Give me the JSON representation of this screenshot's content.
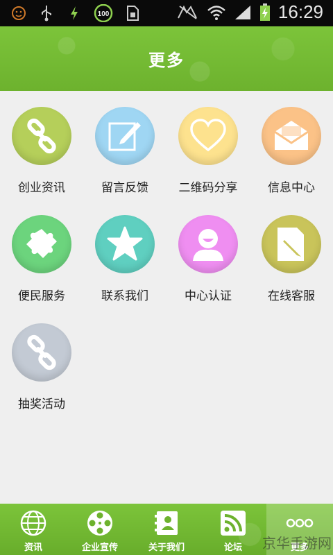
{
  "status_bar": {
    "time": "16:29",
    "battery_badge": "100",
    "icons": [
      "notification-face-icon",
      "usb-icon",
      "charging-bolt-icon",
      "battery-100-icon",
      "sim-icon",
      "no-sim-icon",
      "wifi-icon",
      "signal-icon",
      "battery-charging-icon"
    ]
  },
  "header": {
    "title": "更多"
  },
  "grid": {
    "items": [
      {
        "label": "创业资讯",
        "icon": "link-icon",
        "color": "#b5cf5a"
      },
      {
        "label": "留言反馈",
        "icon": "edit-icon",
        "color": "#9fd6f3"
      },
      {
        "label": "二维码分享",
        "icon": "heart-icon",
        "color": "#fde28e"
      },
      {
        "label": "信息中心",
        "icon": "envelope-icon",
        "color": "#fbc287"
      },
      {
        "label": "便民服务",
        "icon": "puzzle-icon",
        "color": "#6cd47d"
      },
      {
        "label": "联系我们",
        "icon": "star-icon",
        "color": "#5fcfc0"
      },
      {
        "label": "中心认证",
        "icon": "user-icon",
        "color": "#ef8ef1"
      },
      {
        "label": "在线客服",
        "icon": "document-edit-icon",
        "color": "#c9c45a"
      },
      {
        "label": "抽奖活动",
        "icon": "link-icon",
        "color": "#c3cad4"
      }
    ]
  },
  "tabbar": {
    "tabs": [
      {
        "label": "资讯",
        "icon": "globe-icon"
      },
      {
        "label": "企业宣传",
        "icon": "film-reel-icon"
      },
      {
        "label": "关于我们",
        "icon": "contact-book-icon"
      },
      {
        "label": "论坛",
        "icon": "rss-icon"
      },
      {
        "label": "更多",
        "icon": "more-dots-icon",
        "active": true
      }
    ]
  },
  "watermark": "京华手游网"
}
